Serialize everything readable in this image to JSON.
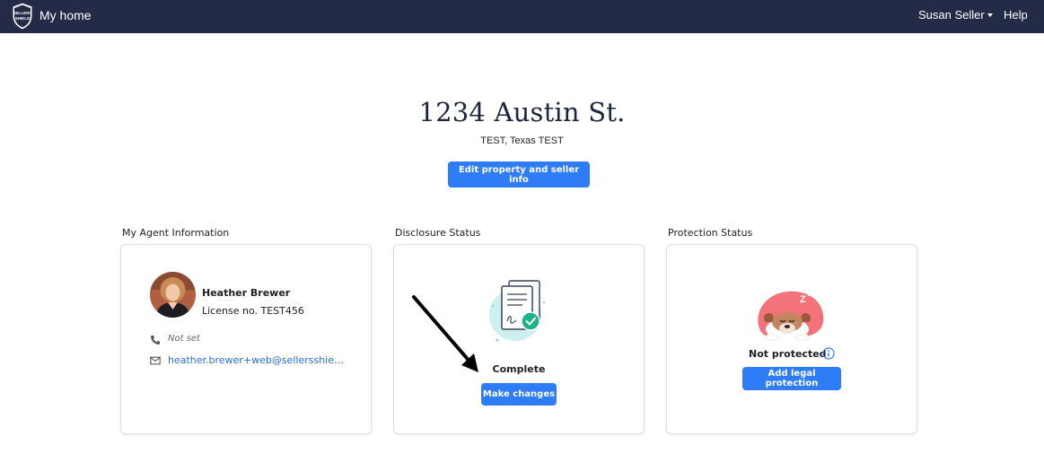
{
  "navbar": {
    "logo_text": "SELLERS SHIELD",
    "title": "My home",
    "user_menu": "Susan Seller",
    "help": "Help"
  },
  "property": {
    "address": "1234 Austin St.",
    "location": "TEST, Texas TEST",
    "edit_button": "Edit property and seller info"
  },
  "agent_section": {
    "label": "My Agent Information",
    "name": "Heather Brewer",
    "license": "License no. TEST456",
    "phone": "Not set",
    "email": "heather.brewer+web@sellersshield..."
  },
  "disclosure_section": {
    "label": "Disclosure Status",
    "status": "Complete",
    "button": "Make changes"
  },
  "protection_section": {
    "label": "Protection Status",
    "status": "Not protected",
    "button": "Add legal protection"
  },
  "colors": {
    "navbar": "#232b47",
    "primary_button": "#2e7cf6",
    "link": "#2a6dd9",
    "success": "#1fb18a",
    "danger_blob": "#f4727a"
  },
  "icons": [
    "sellers-shield-logo",
    "phone-icon",
    "mail-icon",
    "document-check-icon",
    "arrow-icon",
    "sleeping-dog-icon",
    "info-icon"
  ]
}
